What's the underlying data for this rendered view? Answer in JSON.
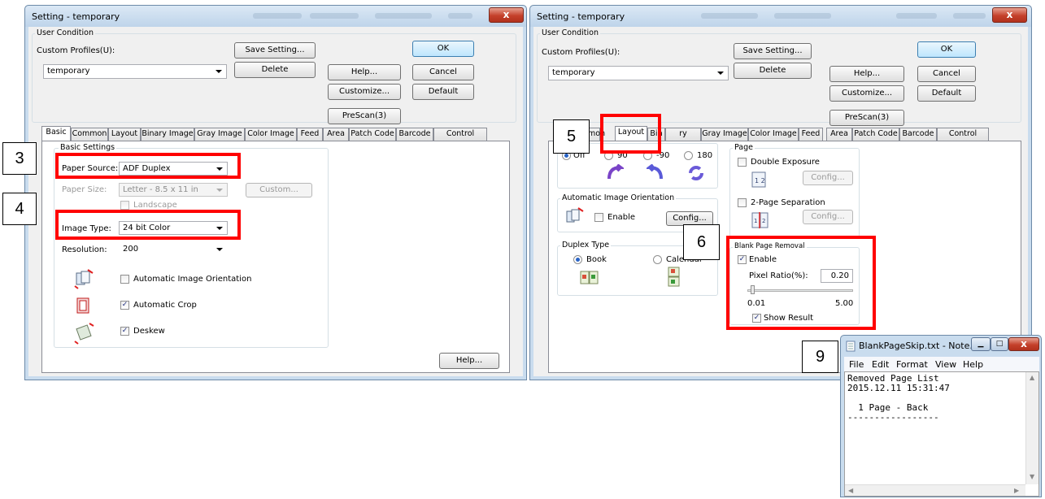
{
  "left_window": {
    "title": "Setting - temporary",
    "close": "x",
    "user_condition": "User Condition",
    "custom_profiles_label": "Custom Profiles(U):",
    "profile_value": "temporary",
    "save_setting": "Save Setting...",
    "delete": "Delete",
    "ok": "OK",
    "cancel": "Cancel",
    "default": "Default",
    "help": "Help...",
    "customize": "Customize...",
    "prescan": "PreScan(3)",
    "tabs": [
      "Basic",
      "Common",
      "Layout",
      "Binary Image",
      "Gray Image",
      "Color Image",
      "Feed",
      "Area",
      "Patch Code",
      "Barcode",
      "Control Sheet"
    ],
    "basic_settings": "Basic Settings",
    "paper_source_label": "Paper Source:",
    "paper_source_value": "ADF Duplex",
    "paper_size_label": "Paper Size:",
    "paper_size_value": "Letter - 8.5 x 11 in",
    "custom": "Custom...",
    "landscape": "Landscape",
    "image_type_label": "Image Type:",
    "image_type_value": "24 bit Color",
    "resolution_label": "Resolution:",
    "resolution_value": "200",
    "auto_orientation": "Automatic Image Orientation",
    "auto_crop": "Automatic Crop",
    "deskew": "Deskew",
    "panel_help": "Help..."
  },
  "right_window": {
    "title": "Setting - temporary",
    "close": "x",
    "user_condition": "User Condition",
    "custom_profiles_label": "Custom Profiles(U):",
    "profile_value": "temporary",
    "save_setting": "Save Setting...",
    "delete": "Delete",
    "ok": "OK",
    "cancel": "Cancel",
    "default": "Default",
    "help": "Help...",
    "customize": "Customize...",
    "prescan": "PreScan(3)",
    "tabs": [
      "B",
      "mon",
      "Layout",
      "Bin",
      "ry Image",
      "Gray Image",
      "Color Image",
      "Feed",
      "Area",
      "Patch Code",
      "Barcode",
      "Control Sheet"
    ],
    "rot_off": "Off",
    "rot_90": "90",
    "rot_m90": "-90",
    "rot_180": "180",
    "auto_orientation_group": "Automatic Image Orientation",
    "enable": "Enable",
    "config": "Config...",
    "duplex_type": "Duplex Type",
    "book": "Book",
    "calendar": "Calendar",
    "page_group": "Page",
    "double_exposure": "Double Exposure",
    "config1": "Config...",
    "two_page_sep": "2-Page Separation",
    "config2": "Config...",
    "blank_page_removal": "Blank Page Removal",
    "bpr_enable": "Enable",
    "pixel_ratio_label": "Pixel Ratio(%):",
    "pixel_ratio_value": "0.20",
    "slider_min": "0.01",
    "slider_max": "5.00",
    "show_result": "Show Result"
  },
  "notepad": {
    "title": "BlankPageSkip.txt - Note...",
    "menu": [
      "File",
      "Edit",
      "Format",
      "View",
      "Help"
    ],
    "text_lines": [
      "Removed Page List",
      "2015.12.11 15:31:47",
      "",
      "  1 Page - Back",
      "-----------------"
    ]
  },
  "callouts": [
    "3",
    "4",
    "5",
    "6",
    "9"
  ],
  "colors": {
    "highlight": "#ff0000",
    "title_bar": "#c9dcee",
    "accent": "#3c7fb1"
  }
}
